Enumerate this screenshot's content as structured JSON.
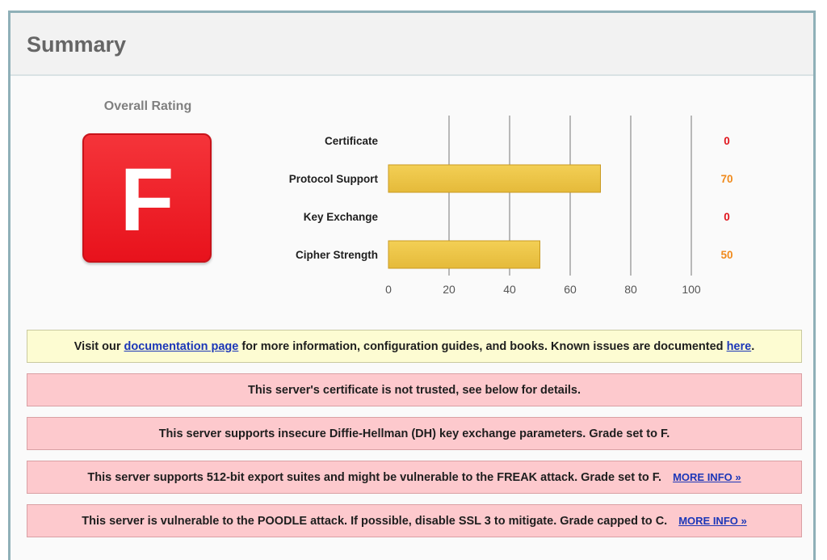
{
  "summary": {
    "title": "Summary",
    "overall_rating_label": "Overall Rating",
    "grade": "F",
    "grade_color": "#e8121c"
  },
  "chart_data": {
    "type": "bar",
    "orientation": "horizontal",
    "categories": [
      "Certificate",
      "Protocol Support",
      "Key Exchange",
      "Cipher Strength"
    ],
    "values": [
      0,
      70,
      0,
      50
    ],
    "value_colors": [
      "#e0141c",
      "#f08a1c",
      "#e0141c",
      "#f08a1c"
    ],
    "bar_color": "#e5ba3a",
    "xlim": [
      0,
      100
    ],
    "xticks": [
      0,
      20,
      40,
      60,
      80,
      100
    ],
    "grid": true
  },
  "notices": {
    "info": {
      "prefix": "Visit our ",
      "link1": "documentation page",
      "middle": " for more information, configuration guides, and books. Known issues are documented ",
      "link2": "here",
      "suffix": "."
    },
    "warnings": [
      {
        "text": "This server's certificate is not trusted, see below for details.",
        "more": ""
      },
      {
        "text": "This server supports insecure Diffie-Hellman (DH) key exchange parameters. Grade set to F.",
        "more": ""
      },
      {
        "text": "This server supports 512-bit export suites and might be vulnerable to the FREAK attack. Grade set to F.",
        "more": "MORE INFO »"
      },
      {
        "text": "This server is vulnerable to the POODLE attack. If possible, disable SSL 3 to mitigate. Grade capped to C.",
        "more": "MORE INFO »"
      }
    ]
  }
}
